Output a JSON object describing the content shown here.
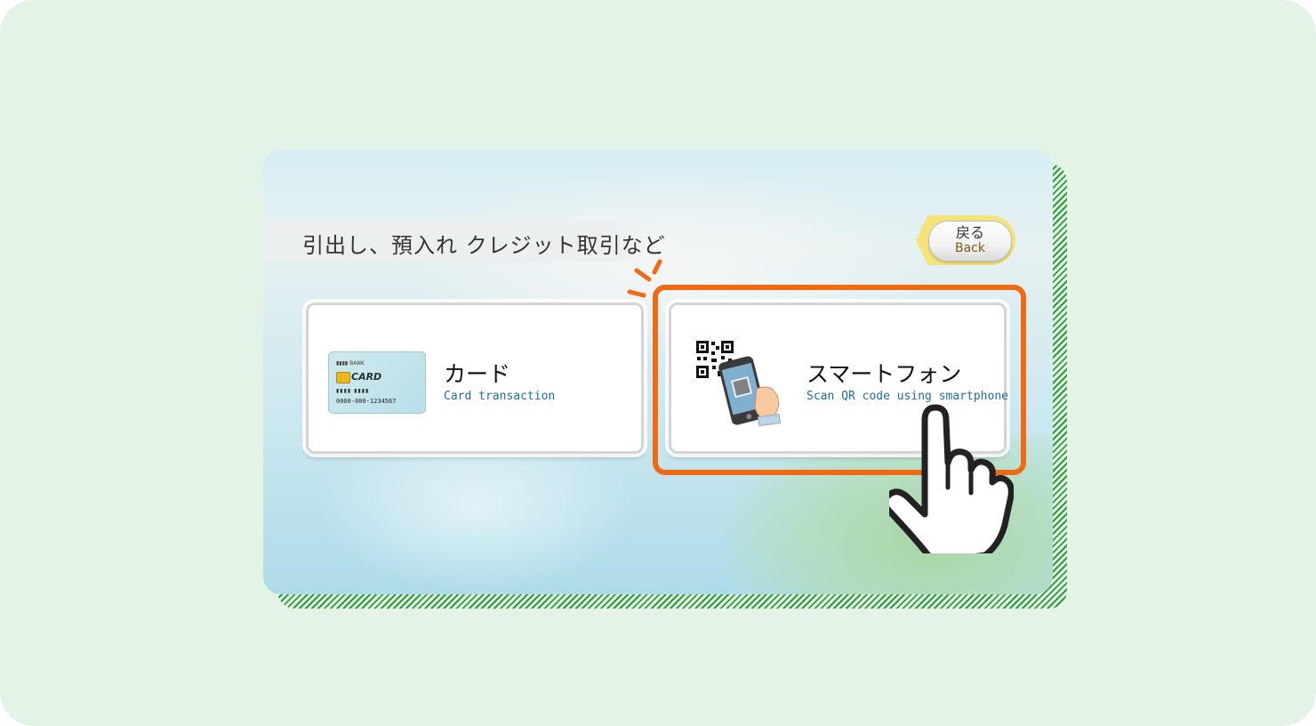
{
  "header": {
    "title": "引出し、預入れ クレジット取引など"
  },
  "back_button": {
    "label_jp": "戻る",
    "label_en": "Back"
  },
  "options": [
    {
      "label_jp": "カード",
      "label_en": "Card transaction",
      "icon": "credit-card-icon",
      "card": {
        "bank": "▮▮▮▮ BANK",
        "name": "CARD",
        "dots": "▮▮▮▮ ▮▮▮▮",
        "number": "0000-000-1234567"
      }
    },
    {
      "label_jp": "スマートフォン",
      "label_en": "Scan QR code using smartphone",
      "icon": "smartphone-qr-icon",
      "highlighted": true
    }
  ],
  "colors": {
    "highlight": "#f06a12",
    "border_stripes": "#2e9b3c",
    "background": "#e3f3e5",
    "back_button_frame": "#f4e27a",
    "subtitle_text": "#1d6f9a"
  },
  "overlay": {
    "pointer": "pointing-hand-icon"
  }
}
